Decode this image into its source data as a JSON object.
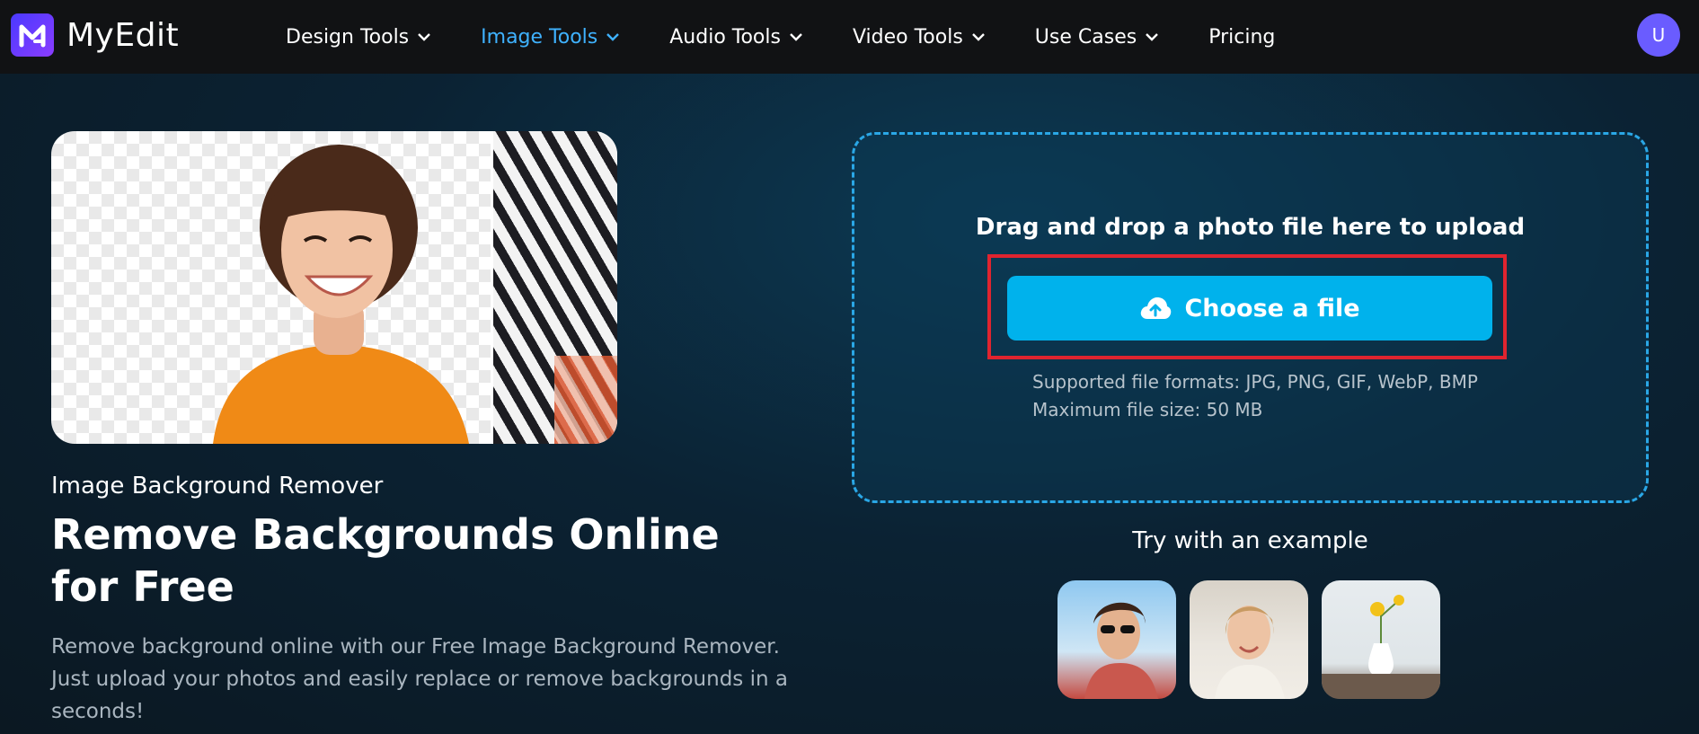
{
  "brand": {
    "name": "MyEdit"
  },
  "nav": {
    "items": [
      {
        "label": "Design Tools",
        "has_dropdown": true,
        "active": false
      },
      {
        "label": "Image Tools",
        "has_dropdown": true,
        "active": true
      },
      {
        "label": "Audio Tools",
        "has_dropdown": true,
        "active": false
      },
      {
        "label": "Video Tools",
        "has_dropdown": true,
        "active": false
      },
      {
        "label": "Use Cases",
        "has_dropdown": true,
        "active": false
      },
      {
        "label": "Pricing",
        "has_dropdown": false,
        "active": false
      }
    ]
  },
  "user": {
    "initial": "U"
  },
  "hero": {
    "eyebrow": "Image Background Remover",
    "headline": "Remove Backgrounds Online for Free",
    "description": "Remove background online with our Free Image Background Remover. Just upload your photos and easily replace or remove backgrounds in a seconds!"
  },
  "upload": {
    "title": "Drag and drop a photo file here to upload",
    "button_label": "Choose a file",
    "formats": "Supported file formats: JPG, PNG, GIF, WebP, BMP",
    "max_size": "Maximum file size: 50 MB"
  },
  "examples": {
    "title": "Try with an example",
    "items": [
      "example-woman-sunglasses",
      "example-woman-smiling",
      "example-flower-vase"
    ]
  },
  "colors": {
    "accent": "#00b2ec",
    "active_nav": "#3fb2ff",
    "highlight": "#e0242f",
    "brand": "#5a3cff"
  },
  "icons": {
    "logo": "myedit-logo-icon",
    "dropdown": "chevron-down-icon",
    "upload": "cloud-upload-icon"
  }
}
